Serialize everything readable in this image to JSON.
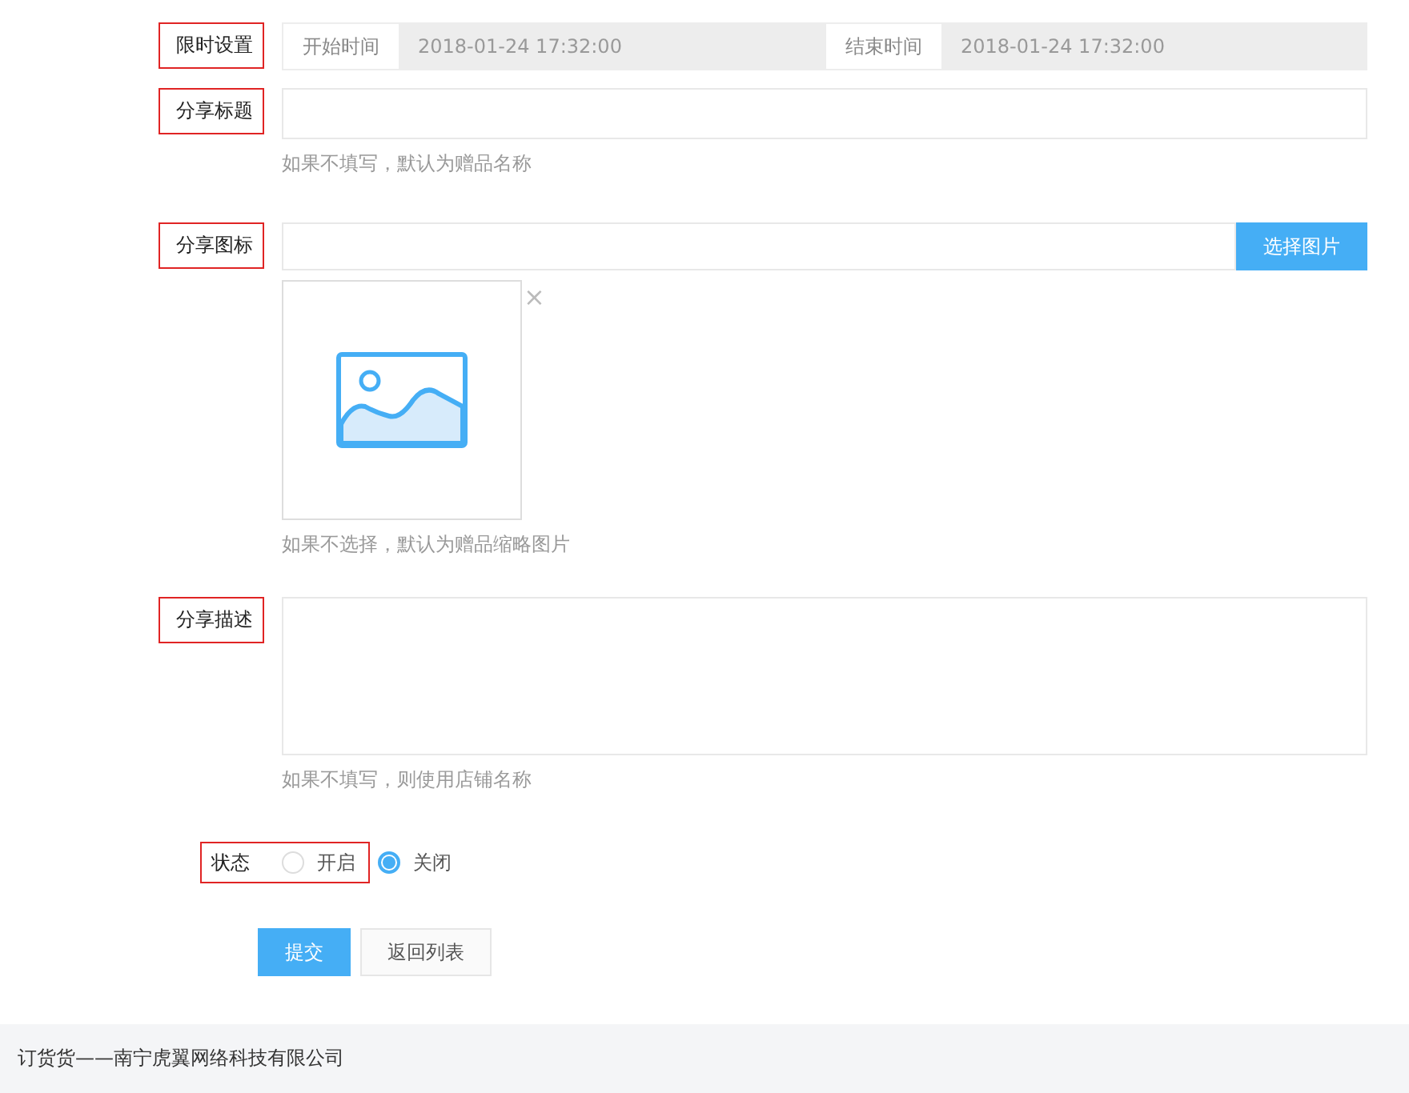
{
  "time_limit": {
    "label": "限时设置",
    "highlighted": true,
    "start_label": "开始时间",
    "start_value": "2018-01-24 17:32:00",
    "end_label": "结束时间",
    "end_value": "2018-01-24 17:32:00"
  },
  "share_title": {
    "label": "分享标题",
    "highlighted": true,
    "hint": "如果不填写，默认为赠品名称"
  },
  "share_icon": {
    "label": "分享图标",
    "highlighted": true,
    "button": "选择图片",
    "remove": "×",
    "hint": "如果不选择，默认为赠品缩略图片"
  },
  "share_description": {
    "label": "分享描述",
    "highlighted": true,
    "hint": "如果不填写，则使用店铺名称"
  },
  "status": {
    "label": "状态",
    "highlighted": true,
    "options": [
      {
        "label": "开启",
        "selected": false
      },
      {
        "label": "关闭",
        "selected": true
      }
    ]
  },
  "buttons": [
    {
      "label": "提交",
      "kind": "primary"
    },
    {
      "label": "返回列表",
      "kind": "default"
    }
  ],
  "footer": "订货货——南宁虎翼网络科技有限公司"
}
